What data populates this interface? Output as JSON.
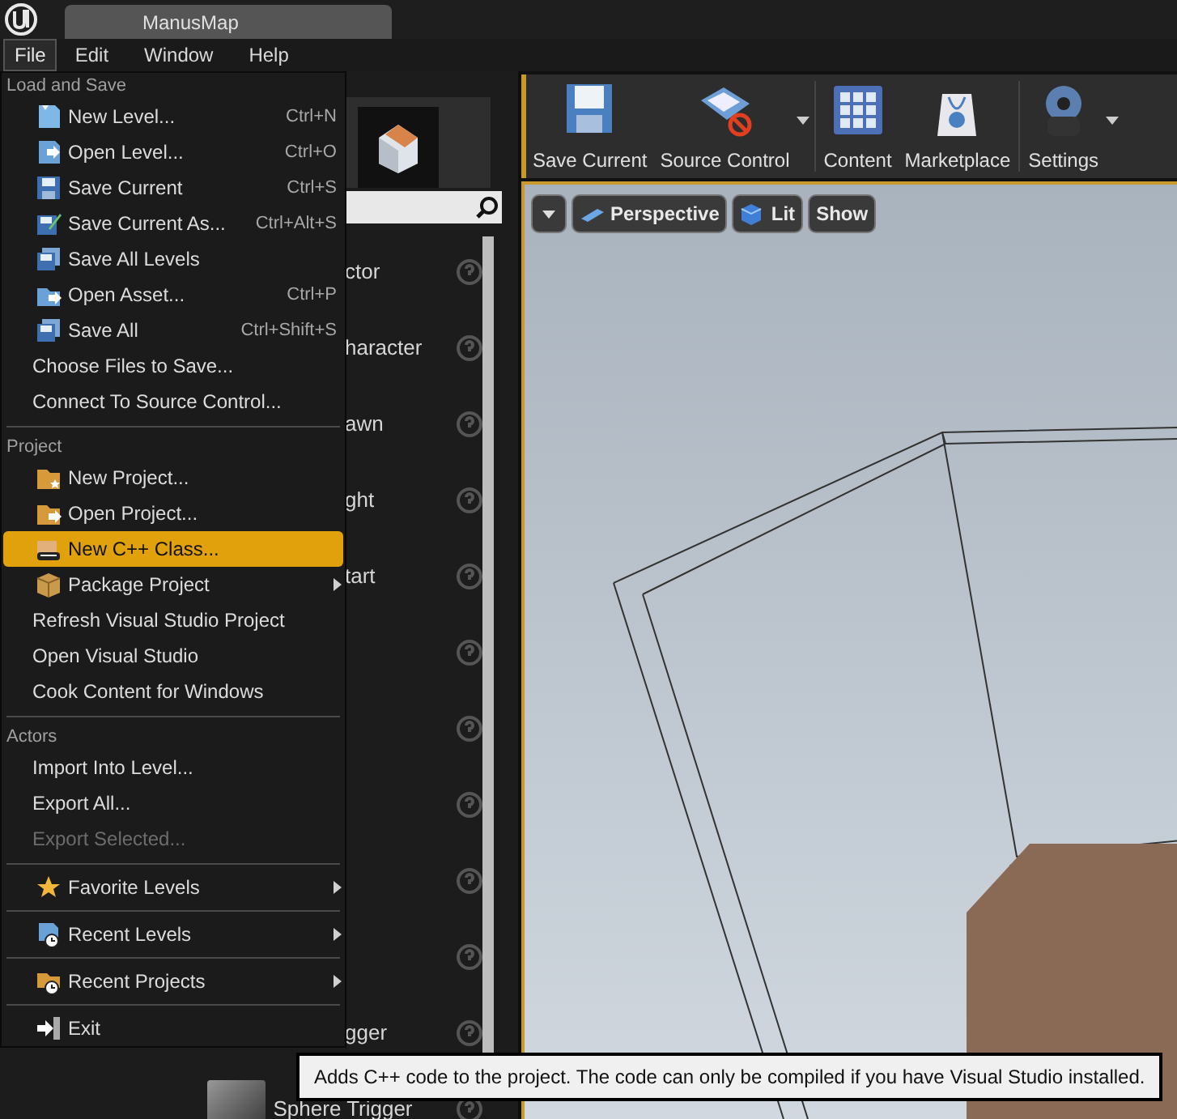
{
  "window": {
    "tab": "ManusMap"
  },
  "menubar": [
    {
      "label": "File",
      "selected": true
    },
    {
      "label": "Edit",
      "selected": false
    },
    {
      "label": "Window",
      "selected": false
    },
    {
      "label": "Help",
      "selected": false
    }
  ],
  "file_menu": {
    "sections": [
      {
        "header": "Load and Save",
        "items": [
          {
            "label": "New Level...",
            "shortcut": "Ctrl+N",
            "selected": false,
            "disabled": false,
            "submenu": false
          },
          {
            "label": "Open Level...",
            "shortcut": "Ctrl+O",
            "selected": false,
            "disabled": false,
            "submenu": false
          },
          {
            "label": "Save Current",
            "shortcut": "Ctrl+S",
            "selected": false,
            "disabled": false,
            "submenu": false
          },
          {
            "label": "Save Current As...",
            "shortcut": "Ctrl+Alt+S",
            "selected": false,
            "disabled": false,
            "submenu": false
          },
          {
            "label": "Save All Levels",
            "selected": false,
            "disabled": false,
            "submenu": false
          },
          {
            "label": "Open Asset...",
            "shortcut": "Ctrl+P",
            "selected": false,
            "disabled": false,
            "submenu": false
          },
          {
            "label": "Save All",
            "shortcut": "Ctrl+Shift+S",
            "selected": false,
            "disabled": false,
            "submenu": false
          },
          {
            "label": "Choose Files to Save...",
            "selected": false,
            "disabled": false,
            "submenu": false
          },
          {
            "label": "Connect To Source Control...",
            "selected": false,
            "disabled": false,
            "submenu": false
          }
        ]
      },
      {
        "header": "Project",
        "items": [
          {
            "label": "New Project...",
            "selected": false,
            "disabled": false,
            "submenu": false
          },
          {
            "label": "Open Project...",
            "selected": false,
            "disabled": false,
            "submenu": false
          },
          {
            "label": "New C++ Class...",
            "selected": true,
            "disabled": false,
            "submenu": false
          },
          {
            "label": "Package Project",
            "selected": false,
            "disabled": false,
            "submenu": true
          },
          {
            "label": "Refresh Visual Studio Project",
            "selected": false,
            "disabled": false,
            "submenu": false
          },
          {
            "label": "Open Visual Studio",
            "selected": false,
            "disabled": false,
            "submenu": false
          },
          {
            "label": "Cook Content for Windows",
            "selected": false,
            "disabled": false,
            "submenu": false
          }
        ]
      },
      {
        "header": "Actors",
        "items": [
          {
            "label": "Import Into Level...",
            "selected": false,
            "disabled": false,
            "submenu": false
          },
          {
            "label": "Export All...",
            "selected": false,
            "disabled": false,
            "submenu": false
          },
          {
            "label": "Export Selected...",
            "selected": false,
            "disabled": true,
            "submenu": false
          }
        ]
      },
      {
        "items": [
          {
            "label": "Favorite Levels",
            "selected": false,
            "disabled": false,
            "submenu": true
          }
        ]
      },
      {
        "items": [
          {
            "label": "Recent Levels",
            "selected": false,
            "disabled": false,
            "submenu": true
          }
        ]
      },
      {
        "items": [
          {
            "label": "Recent Projects",
            "selected": false,
            "disabled": false,
            "submenu": true
          }
        ]
      },
      {
        "items": [
          {
            "label": "Exit",
            "selected": false,
            "disabled": false,
            "submenu": false
          }
        ]
      }
    ]
  },
  "place_panel": {
    "items": [
      {
        "name": "ctor",
        "clipped": true
      },
      {
        "name": "haracter",
        "clipped": true
      },
      {
        "name": "awn",
        "clipped": true
      },
      {
        "name": "ght",
        "clipped": true
      },
      {
        "name": "tart",
        "clipped": true
      },
      {
        "help_icon": true
      },
      {
        "help_icon": true
      },
      {
        "help_icon": true
      },
      {
        "help_icon": true
      },
      {
        "help_icon": true
      },
      {
        "name": "gger",
        "clipped": true
      },
      {
        "name": "Sphere Trigger",
        "clipped": false
      }
    ]
  },
  "toolbar": [
    {
      "label": "Save Current",
      "dropdown": false
    },
    {
      "label": "Source Control",
      "dropdown": true
    },
    {
      "label": "Content",
      "dropdown": false
    },
    {
      "label": "Marketplace",
      "dropdown": false
    },
    {
      "label": "Settings",
      "dropdown": true
    }
  ],
  "viewport_toolbar": [
    "Perspective",
    "Lit",
    "Show"
  ],
  "tooltip": "Adds C++ code to the project. The code can only be compiled if you have Visual Studio installed."
}
